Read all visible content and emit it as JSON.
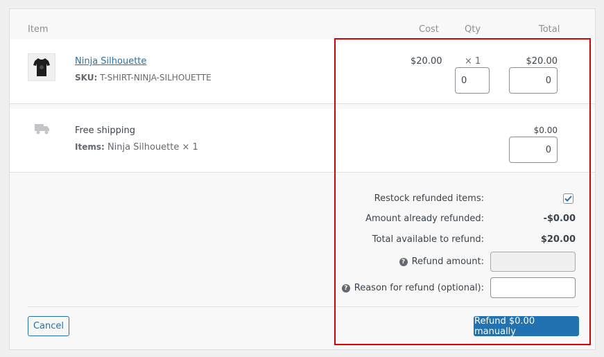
{
  "headers": {
    "item": "Item",
    "cost": "Cost",
    "qty": "Qty",
    "total": "Total"
  },
  "product": {
    "name": "Ninja Silhouette",
    "sku_label": "SKU:",
    "sku_value": "T-SHIRT-NINJA-SILHOUETTE",
    "cost": "$20.00",
    "qty_display": "× 1",
    "qty_refund_value": "0",
    "total": "$20.00",
    "total_refund_value": "0",
    "thumbnail_icon": "tshirt-icon"
  },
  "shipping": {
    "name": "Free shipping",
    "items_label": "Items:",
    "items_value": "Ninja Silhouette × 1",
    "total": "$0.00",
    "total_refund_value": "0",
    "icon": "truck-icon"
  },
  "refund": {
    "restock_label": "Restock refunded items:",
    "restock_checked": true,
    "already_refunded_label": "Amount already refunded:",
    "already_refunded_value": "-$0.00",
    "available_label": "Total available to refund:",
    "available_value": "$20.00",
    "amount_label": "Refund amount:",
    "amount_value": "",
    "reason_label": "Reason for refund (optional):",
    "reason_value": "",
    "help_icon": "question-circle-icon"
  },
  "actions": {
    "cancel_label": "Cancel",
    "refund_manual_label": "Refund $0.00 manually"
  },
  "colors": {
    "accent": "#2271b1",
    "highlight": "#e00000"
  }
}
